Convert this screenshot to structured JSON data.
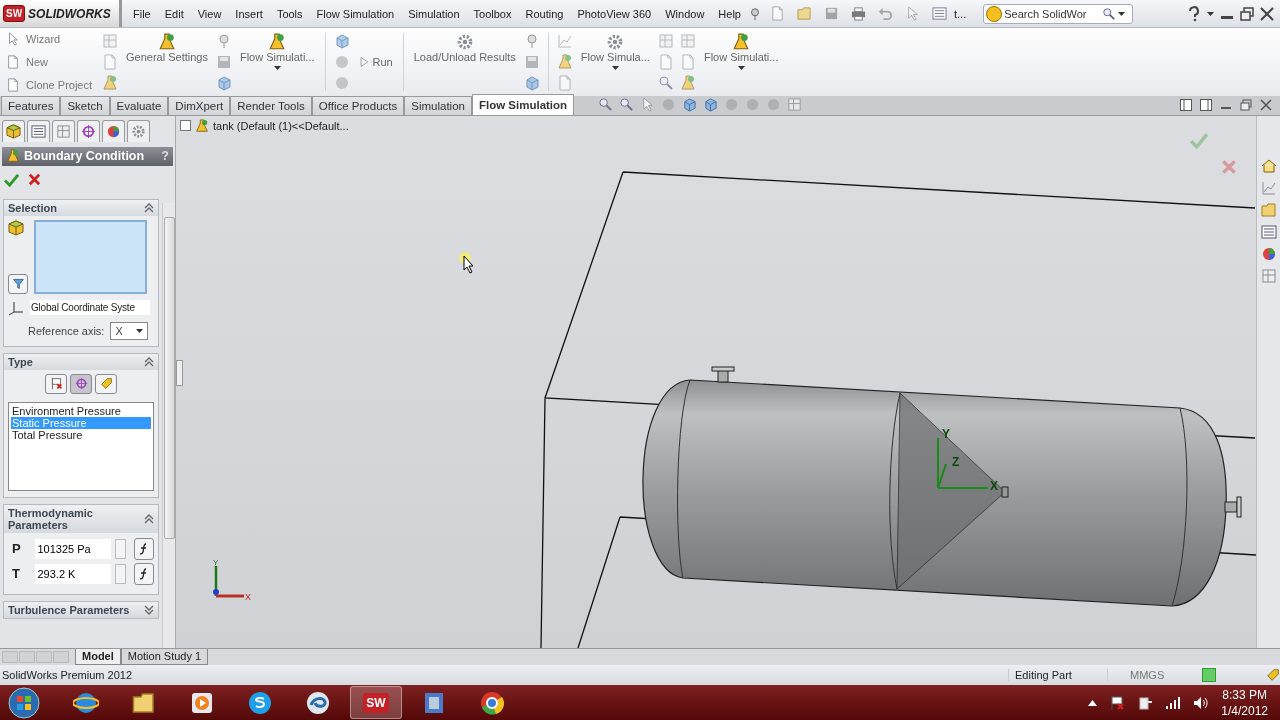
{
  "logo": {
    "badge": "SW",
    "name": "SOLIDWORKS"
  },
  "menu": [
    "File",
    "Edit",
    "View",
    "Insert",
    "Tools",
    "Flow Simulation",
    "Simulation",
    "Toolbox",
    "Routing",
    "PhotoView 360",
    "Window",
    "Help"
  ],
  "quick_overflow": "t...",
  "search": {
    "placeholder": "Search SolidWor"
  },
  "commands": [
    {
      "kind": "stack",
      "items": [
        "Wizard",
        "New",
        "Clone Project"
      ]
    },
    {
      "kind": "tool_column"
    },
    {
      "kind": "large",
      "label": "General Settings",
      "dropdown": false
    },
    {
      "kind": "tool_column"
    },
    {
      "kind": "large",
      "label": "Flow Simulati...",
      "dropdown": true
    },
    {
      "kind": "separator"
    },
    {
      "kind": "tool_column"
    },
    {
      "kind": "inline",
      "label": "Run"
    },
    {
      "kind": "separator"
    },
    {
      "kind": "large",
      "label": "Load/Unload Results",
      "dropdown": false
    },
    {
      "kind": "tool_column"
    },
    {
      "kind": "separator"
    },
    {
      "kind": "tool_column"
    },
    {
      "kind": "large",
      "label": "Flow Simula...",
      "dropdown": true
    },
    {
      "kind": "tool_column"
    },
    {
      "kind": "tool_column"
    },
    {
      "kind": "large",
      "label": "Flow Simulati...",
      "dropdown": true
    }
  ],
  "tabs": [
    {
      "label": "Features",
      "selected": false
    },
    {
      "label": "Sketch",
      "selected": false
    },
    {
      "label": "Evaluate",
      "selected": false
    },
    {
      "label": "DimXpert",
      "selected": false
    },
    {
      "label": "Render Tools",
      "selected": false
    },
    {
      "label": "Office Products",
      "selected": false
    },
    {
      "label": "Simulation",
      "selected": false
    },
    {
      "label": "Flow Simulation",
      "selected": true
    }
  ],
  "tree_item": "tank  (Default (1)<<Default...",
  "panel": {
    "title": "Boundary Condition",
    "help": "?",
    "selection": {
      "title": "Selection",
      "expanded": true,
      "coordinate_system": "Global Coordinate Syste",
      "reference_axis_label": "Reference axis:",
      "reference_axis": "X"
    },
    "type": {
      "title": "Type",
      "expanded": true,
      "buttons": [
        {
          "selected": false
        },
        {
          "selected": true
        },
        {
          "selected": false
        }
      ],
      "options": [
        {
          "label": "Environment Pressure",
          "selected": false
        },
        {
          "label": "Static Pressure",
          "selected": true
        },
        {
          "label": "Total Pressure",
          "selected": false
        }
      ]
    },
    "thermodynamic": {
      "title": "Thermodynamic Parameters",
      "expanded": true,
      "params": [
        {
          "symbol": "P",
          "value": "101325 Pa"
        },
        {
          "symbol": "T",
          "value": "293.2 K"
        }
      ]
    },
    "turbulence": {
      "title": "Turbulence Parameters",
      "expanded": false
    }
  },
  "model_triad": [
    "Y",
    "Z",
    "X"
  ],
  "view_triad": [
    "Y",
    "X"
  ],
  "bottom_tabs": [
    {
      "label": "Model",
      "selected": true
    },
    {
      "label": "Motion Study 1",
      "selected": false
    }
  ],
  "status": {
    "product": "SolidWorks Premium 2012",
    "mode": "Editing Part",
    "units": "MMGS"
  },
  "taskbar": {
    "apps": [
      {
        "kind": "browser",
        "active": false
      },
      {
        "kind": "folder",
        "active": false
      },
      {
        "kind": "media",
        "active": false
      },
      {
        "kind": "chat",
        "active": false
      },
      {
        "kind": "swirl",
        "active": false
      },
      {
        "kind": "cad",
        "badge": "SW",
        "active": true
      },
      {
        "kind": "film",
        "active": false
      },
      {
        "kind": "chrome",
        "active": false
      }
    ],
    "time": "8:33 PM",
    "date": "1/4/2012"
  }
}
